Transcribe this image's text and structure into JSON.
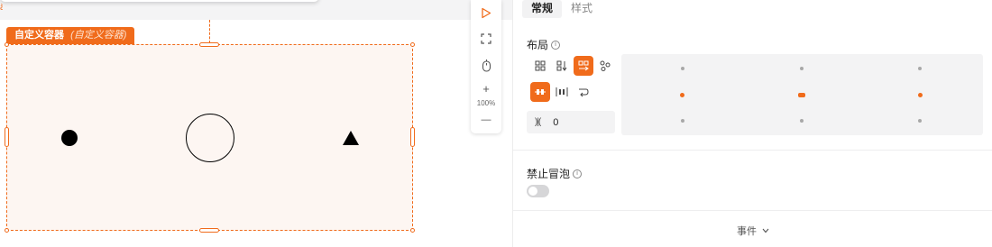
{
  "canvas": {
    "left_edge_char": "ä",
    "container": {
      "title": "自定义容器",
      "alias": "(自定义容器)"
    },
    "toolbar": {
      "zoom_in": "+",
      "zoom_level": "100%",
      "zoom_out": "—"
    }
  },
  "panel": {
    "tabs": [
      {
        "label": "常规",
        "active": true
      },
      {
        "label": "样式",
        "active": false
      }
    ],
    "layout": {
      "label": "布局",
      "gap_value": "0",
      "alignment_grid_selected": "middle-row"
    },
    "bubble": {
      "label": "禁止冒泡",
      "enabled": false
    },
    "events": {
      "label": "事件"
    }
  },
  "colors": {
    "accent": "#f06b1b",
    "container_fill": "#fdf6f2"
  }
}
